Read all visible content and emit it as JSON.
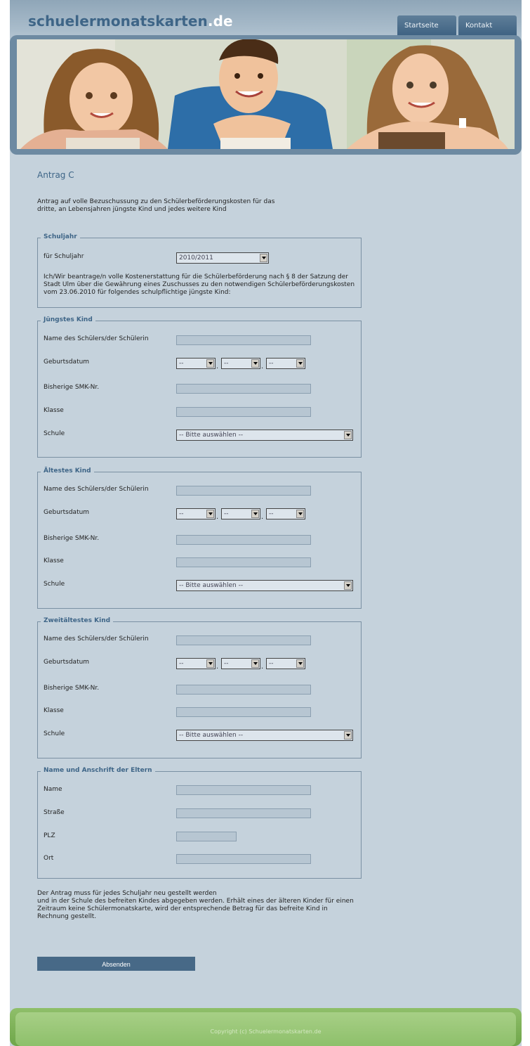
{
  "header": {
    "logo_main": "schuelermonatskarten",
    "logo_tld": ".de",
    "nav": [
      {
        "label": "Startseite"
      },
      {
        "label": "Kontakt"
      }
    ]
  },
  "main": {
    "title": "Antrag C",
    "intro": "Antrag auf volle Bezuschussung zu den Schülerbeförderungskosten für das dritte, an Lebensjahren jüngste Kind und jedes weitere Kind",
    "schuljahr": {
      "legend": "Schuljahr",
      "label": "für Schuljahr",
      "value": "2010/2011",
      "note": "Ich/Wir beantrage/n volle Kostenerstattung für die Schülerbeförderung nach § 8 der Satzung der Stadt Ulm über die Gewährung eines Zuschusses zu den notwendigen Schülerbeförderungskosten vom 23.06.2010 für folgendes schulpflichtige jüngste Kind:"
    },
    "children": [
      {
        "legend": "Jüngstes Kind"
      },
      {
        "legend": "Ältestes Kind"
      },
      {
        "legend": "Zweitältestes Kind"
      }
    ],
    "child_labels": {
      "name": "Name des Schülers/der Schülerin",
      "birth": "Geburtsdatum",
      "smk": "Bisherige SMK-Nr.",
      "klasse": "Klasse",
      "schule": "Schule"
    },
    "date_placeholder": "--",
    "date_separator": ".",
    "school_placeholder": "-- Bitte auswählen --",
    "parents": {
      "legend": "Name und Anschrift der Eltern",
      "name": "Name",
      "strasse": "Straße",
      "plz": "PLZ",
      "ort": "Ort"
    },
    "footnote": "Der Antrag muss für jedes Schuljahr neu gestellt werden und in der Schule des befreiten Kindes abgegeben werden. Erhält eines der älteren Kinder für einen Zeitraum keine Schülermonatskarte, wird der entsprechende Betrag für das befreite Kind in Rechnung gestellt.",
    "footnote_line1": "Der Antrag muss für jedes Schuljahr neu gestellt werden",
    "footnote_line2": "und in der Schule des befreiten Kindes abgegeben werden. Erhält eines der älteren Kinder für einen Zeitraum keine Schülermonatskarte, wird der entsprechende Betrag für das befreite Kind in Rechnung gestellt.",
    "submit": "Absenden"
  },
  "footer": {
    "copyright": "Copyright (c) Schuelermonatskarten.de"
  },
  "colors": {
    "background": "#c5d2dc",
    "accent": "#3e6587",
    "button": "#476987",
    "footer": "#8ec06b"
  }
}
